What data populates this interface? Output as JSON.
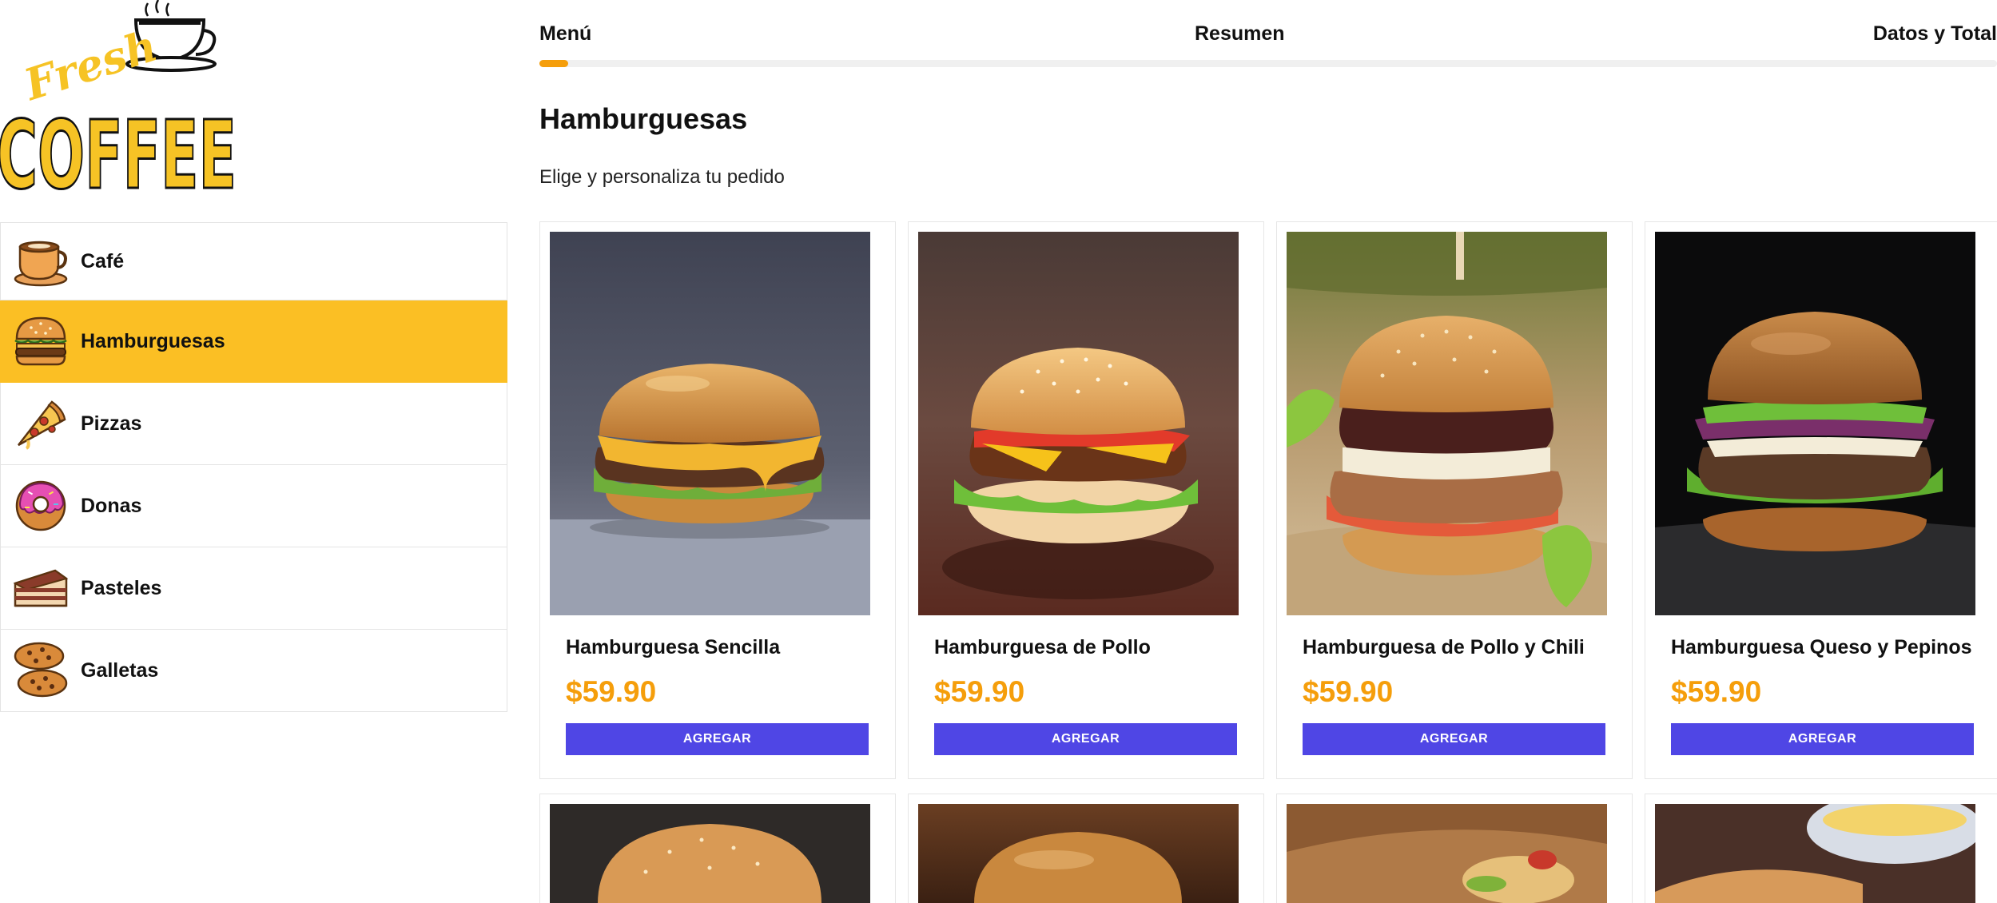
{
  "logo": {
    "line1": "Fresh",
    "line2": "COFFEE"
  },
  "steps": [
    {
      "label": "Menú"
    },
    {
      "label": "Resumen"
    },
    {
      "label": "Datos y Total"
    }
  ],
  "progress": {
    "fraction": 0.02
  },
  "sidebar": {
    "items": [
      {
        "label": "Café",
        "icon": "coffee-cup-icon"
      },
      {
        "label": "Hamburguesas",
        "icon": "burger-icon",
        "active": true
      },
      {
        "label": "Pizzas",
        "icon": "pizza-slice-icon"
      },
      {
        "label": "Donas",
        "icon": "donut-icon"
      },
      {
        "label": "Pasteles",
        "icon": "cake-icon"
      },
      {
        "label": "Galletas",
        "icon": "cookies-icon"
      }
    ]
  },
  "main": {
    "title": "Hamburguesas",
    "subtitle": "Elige y personaliza tu pedido"
  },
  "products": [
    {
      "name": "Hamburguesa Sencilla",
      "price": "$59.90",
      "button": "AGREGAR"
    },
    {
      "name": "Hamburguesa de Pollo",
      "price": "$59.90",
      "button": "AGREGAR"
    },
    {
      "name": "Hamburguesa de Pollo y Chili",
      "price": "$59.90",
      "button": "AGREGAR"
    },
    {
      "name": "Hamburguesa Queso y Pepinos",
      "price": "$59.90",
      "button": "AGREGAR"
    },
    {
      "name": "",
      "price": "",
      "button": ""
    },
    {
      "name": "",
      "price": "",
      "button": ""
    },
    {
      "name": "",
      "price": "",
      "button": ""
    },
    {
      "name": "",
      "price": "",
      "button": ""
    }
  ],
  "colors": {
    "accent": "#fbbf24",
    "price": "#f59e0b",
    "button": "#4f46e5",
    "progress": "#f59e0b"
  }
}
